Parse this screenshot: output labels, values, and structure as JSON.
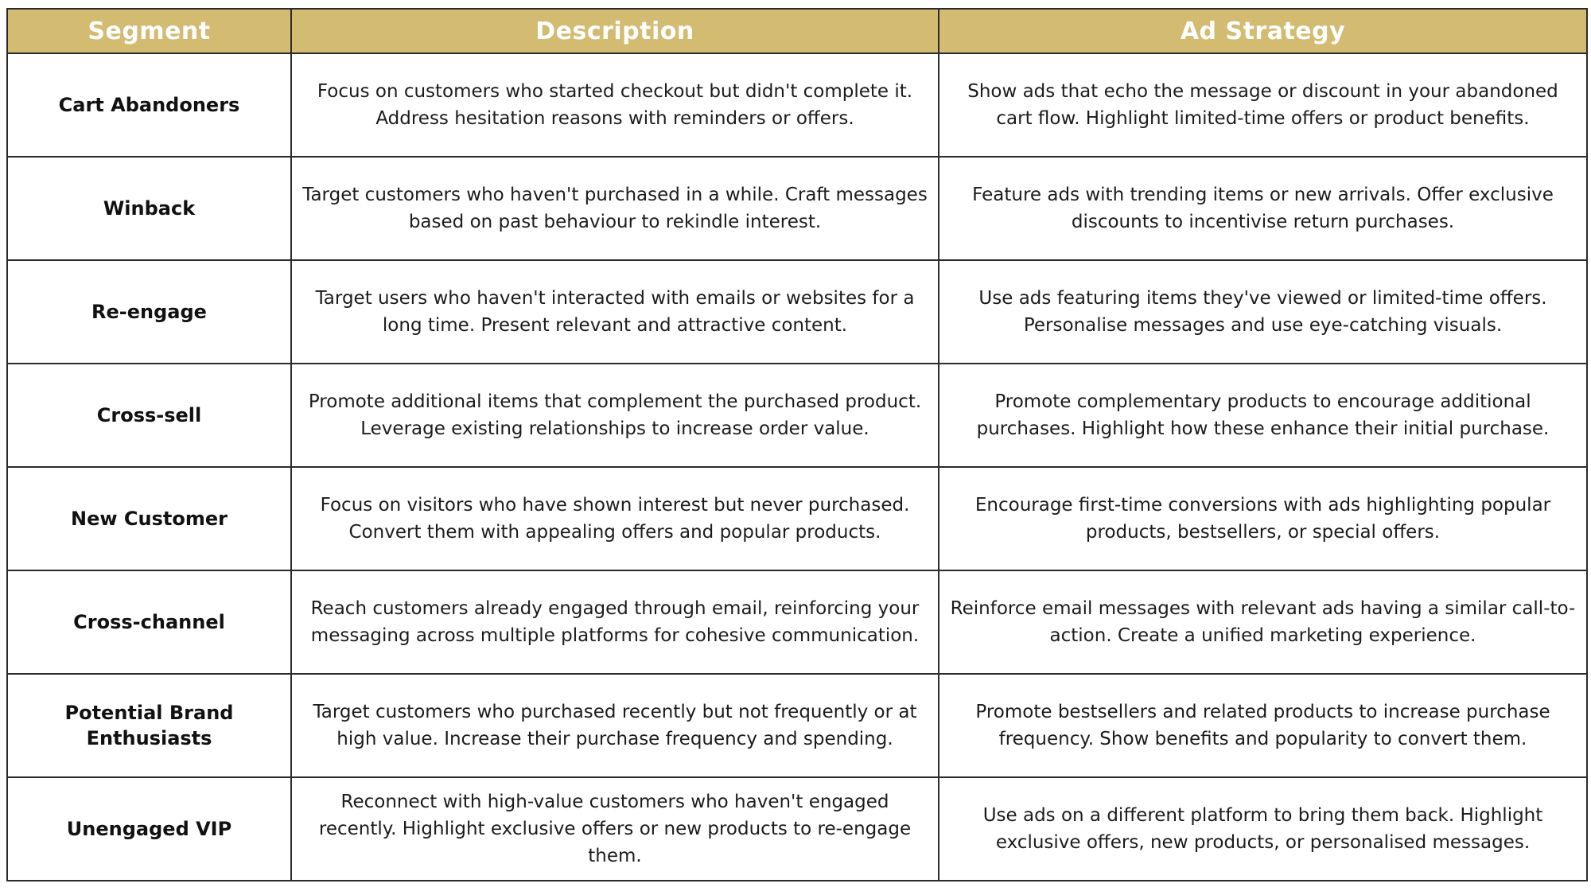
{
  "header_color": "#d3bb72",
  "columns": [
    "Segment",
    "Description",
    "Ad Strategy"
  ],
  "rows": [
    {
      "segment": "Cart Abandoners",
      "description": "Focus on customers who started checkout but didn't complete it. Address hesitation reasons with reminders or offers.",
      "strategy": "Show ads that echo the message or discount in your abandoned cart flow. Highlight limited-time offers or product benefits."
    },
    {
      "segment": "Winback",
      "description": "Target customers who haven't purchased in a while. Craft messages based on past behaviour to rekindle interest.",
      "strategy": "Feature ads with trending items or new arrivals. Offer exclusive discounts to incentivise return purchases."
    },
    {
      "segment": "Re-engage",
      "description": "Target users who haven't interacted with emails or websites for a long time. Present relevant and attractive content.",
      "strategy": "Use ads featuring items they've viewed or limited-time offers. Personalise messages and use eye-catching visuals."
    },
    {
      "segment": "Cross-sell",
      "description": "Promote additional items that complement the purchased product. Leverage existing relationships to increase order value.",
      "strategy": "Promote complementary products to encourage additional purchases. Highlight how these enhance their initial purchase."
    },
    {
      "segment": "New Customer",
      "description": "Focus on visitors who have shown interest but never purchased. Convert them with appealing offers and popular products.",
      "strategy": "Encourage first-time conversions with ads highlighting popular products, bestsellers, or special offers."
    },
    {
      "segment": "Cross-channel",
      "description": "Reach customers already engaged through email, reinforcing your messaging across multiple platforms for cohesive communication.",
      "strategy": "Reinforce email messages with relevant ads having a similar call-to-action. Create a unified marketing experience."
    },
    {
      "segment": "Potential Brand Enthusiasts",
      "description": "Target customers who purchased recently but not frequently or at high value. Increase their purchase frequency and spending.",
      "strategy": "Promote bestsellers and related products to increase purchase frequency. Show benefits and popularity to convert them."
    },
    {
      "segment": "Unengaged VIP",
      "description": "Reconnect with high-value customers who haven't engaged recently. Highlight exclusive offers or new products to re-engage them.",
      "strategy": "Use ads on a different platform to bring them back. Highlight exclusive offers, new products, or personalised messages."
    }
  ]
}
